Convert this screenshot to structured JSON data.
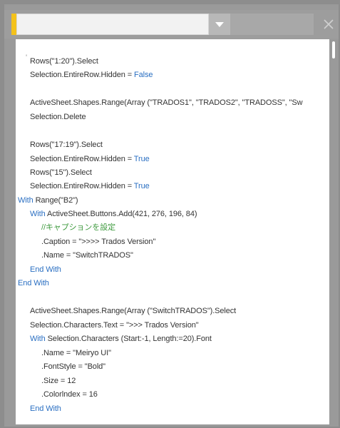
{
  "window": {
    "title_value": "",
    "accent_color": "#f4c21b",
    "dropdown_icon": "chevron-down-icon",
    "close_icon": "close-icon"
  },
  "code": {
    "keyword_color": "#2a6fc2",
    "comment_color": "#3e9a3e",
    "lines": [
      "'",
      "Rows(\"1:20\").Select",
      "Selection.EntireRow.Hidden = ",
      "False",
      "ActiveSheet.Shapes.Range(Array (\"TRADOS1\", \"TRADOS2\", \"TRADOSS\", \"Sw",
      "Selection.Delete",
      "Rows(\"17:19\").Select",
      "Selection.EntireRow.Hidden = ",
      "True",
      "Rows(\"15\").Select",
      "Selection.EntireRow.Hidden = ",
      "True",
      "With",
      " Range(\"B2\")",
      "With",
      " ActiveSheet.Buttons.Add(421, 276, 196, 84)",
      "//キャプションを設定",
      ".Caption = \">>>> Trados Version\"",
      ".Name = \"SwitchTRADOS\"",
      "End With",
      "End With",
      "ActiveSheet.Shapes.Range(Array (\"SwitchTRADOS\").Select",
      "Selection.Characters.Text = \">>> Trados Version\"",
      "With",
      " Selection.Characters (Start:-1, Length:=20).Font",
      ".Name = \"Meiryo UI\"",
      ".FontStyle = \"Bold\"",
      ".Size = 12",
      ".Colorlndex = 16",
      "End With"
    ]
  }
}
